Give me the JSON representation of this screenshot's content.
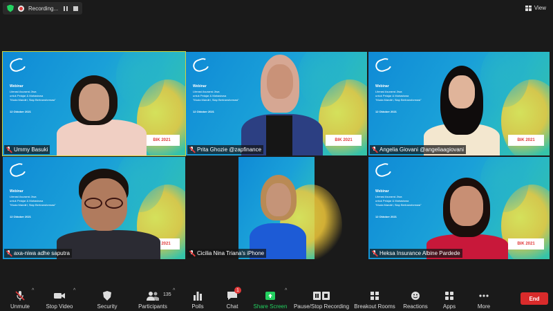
{
  "top_bar": {
    "recording_label": "Recording...",
    "view_label": "View"
  },
  "slide": {
    "title": "Webinar",
    "subtitle_line1": "Literasi Asuransi Jiwa",
    "subtitle_line2": "untuk Pelajar & Mahasiswa",
    "subtitle_line3": "\"Muda Mandiri, Siap Bertransformasi\"",
    "date": "12 Oktober 2021",
    "bmn": "BIK 2021"
  },
  "participants": [
    {
      "name": "Ummy Basuki",
      "muted": true,
      "active_speaker": true
    },
    {
      "name": "Prita Ghozie @zapfinance",
      "muted": true
    },
    {
      "name": "Angelia Giovani @angeliaagiovani",
      "muted": true
    },
    {
      "name": "axa-niwa adhe saputra",
      "muted": true
    },
    {
      "name": "Cicilia Nina Triana's iPhone",
      "muted": true
    },
    {
      "name": "Heksa Insurance Albine Pardede",
      "muted": true
    }
  ],
  "toolbar": {
    "unmute": "Unmute",
    "stop_video": "Stop Video",
    "security": "Security",
    "participants": "Participants",
    "participants_count": "135",
    "polls": "Polls",
    "chat": "Chat",
    "chat_badge": "1",
    "share_screen": "Share Screen",
    "pause_recording": "Pause/Stop Recording",
    "breakout_rooms": "Breakout Rooms",
    "reactions": "Reactions",
    "apps": "Apps",
    "more": "More",
    "end": "End"
  },
  "colors": {
    "active_speaker_border": "#d4d23a",
    "end_button": "#d92b2b",
    "share_green": "#23d160",
    "slide_blue": "#1aa0d8"
  }
}
